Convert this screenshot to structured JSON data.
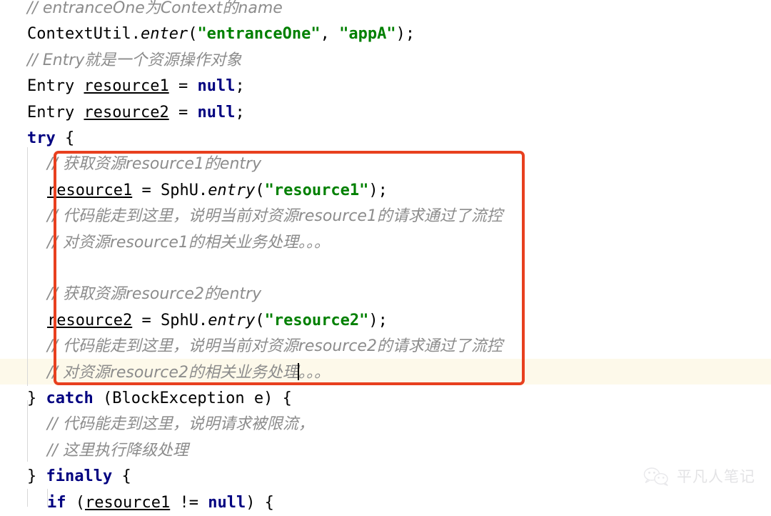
{
  "editor": {
    "language": "Java",
    "theme": "light",
    "caret_line_index": 13,
    "colors": {
      "background": "#ffffff",
      "keyword": "#000080",
      "string": "#008000",
      "comment": "#8c8c8c",
      "plain": "#000000",
      "current_line_highlight": "#fdf9ea",
      "annotation_box": "#e8401f",
      "indent_guide": "#d8d8d8",
      "watermark": "#c9c9cd"
    }
  },
  "annotation": {
    "name": "red-highlight-rectangle",
    "color": "#e8401f",
    "label": "",
    "covers_lines": "5-14"
  },
  "code_lines": [
    {
      "index": 0,
      "indent": 1,
      "tokens": [
        {
          "type": "comment",
          "text": "// entranceOne为Context的name"
        }
      ]
    },
    {
      "index": 1,
      "indent": 1,
      "tokens": [
        {
          "type": "plain",
          "text": "ContextUtil."
        },
        {
          "type": "method",
          "text": "enter"
        },
        {
          "type": "plain",
          "text": "("
        },
        {
          "type": "str",
          "text": "\"entranceOne\""
        },
        {
          "type": "plain",
          "text": ", "
        },
        {
          "type": "str",
          "text": "\"appA\""
        },
        {
          "type": "plain",
          "text": ");"
        }
      ]
    },
    {
      "index": 2,
      "indent": 1,
      "tokens": [
        {
          "type": "comment",
          "text": "// Entry就是一个资源操作对象"
        }
      ]
    },
    {
      "index": 3,
      "indent": 1,
      "tokens": [
        {
          "type": "type",
          "text": "Entry "
        },
        {
          "type": "var",
          "text": "resource1"
        },
        {
          "type": "plain",
          "text": " = "
        },
        {
          "type": "kw",
          "text": "null"
        },
        {
          "type": "plain",
          "text": ";"
        }
      ]
    },
    {
      "index": 4,
      "indent": 1,
      "tokens": [
        {
          "type": "type",
          "text": "Entry "
        },
        {
          "type": "var",
          "text": "resource2"
        },
        {
          "type": "plain",
          "text": " = "
        },
        {
          "type": "kw",
          "text": "null"
        },
        {
          "type": "plain",
          "text": ";"
        }
      ]
    },
    {
      "index": 5,
      "indent": 1,
      "tokens": [
        {
          "type": "kw",
          "text": "try"
        },
        {
          "type": "plain",
          "text": " {"
        }
      ]
    },
    {
      "index": 6,
      "indent": 2,
      "tokens": [
        {
          "type": "comment",
          "text": "// 获取资源resource1的entry"
        }
      ]
    },
    {
      "index": 7,
      "indent": 2,
      "tokens": [
        {
          "type": "var",
          "text": "resource1"
        },
        {
          "type": "plain",
          "text": " = SphU."
        },
        {
          "type": "method",
          "text": "entry"
        },
        {
          "type": "plain",
          "text": "("
        },
        {
          "type": "str",
          "text": "\"resource1\""
        },
        {
          "type": "plain",
          "text": ");"
        }
      ]
    },
    {
      "index": 8,
      "indent": 2,
      "tokens": [
        {
          "type": "comment",
          "text": "// 代码能走到这里，说明当前对资源resource1的请求通过了流控"
        }
      ]
    },
    {
      "index": 9,
      "indent": 2,
      "tokens": [
        {
          "type": "comment",
          "text": "// 对资源resource1的相关业务处理。。。"
        }
      ]
    },
    {
      "index": 10,
      "indent": 2,
      "tokens": []
    },
    {
      "index": 11,
      "indent": 2,
      "tokens": [
        {
          "type": "comment",
          "text": "// 获取资源resource2的entry"
        }
      ]
    },
    {
      "index": 12,
      "indent": 2,
      "tokens": [
        {
          "type": "var",
          "text": "resource2"
        },
        {
          "type": "plain",
          "text": " = SphU."
        },
        {
          "type": "method",
          "text": "entry"
        },
        {
          "type": "plain",
          "text": "("
        },
        {
          "type": "str",
          "text": "\"resource2\""
        },
        {
          "type": "plain",
          "text": ");"
        }
      ]
    },
    {
      "index": 13,
      "indent": 2,
      "tokens": [
        {
          "type": "comment",
          "text": "// 代码能走到这里，说明当前对资源resource2的请求通过了流控"
        }
      ]
    },
    {
      "index": 14,
      "indent": 2,
      "caret_after": "// 对资源resource2的相关业务处理",
      "tokens": [
        {
          "type": "comment",
          "text": "// 对资源resource2的相关业务处理"
        },
        {
          "type": "caret",
          "text": ""
        },
        {
          "type": "comment",
          "text": "。。。"
        }
      ]
    },
    {
      "index": 15,
      "indent": 1,
      "tokens": [
        {
          "type": "plain",
          "text": "} "
        },
        {
          "type": "kw",
          "text": "catch"
        },
        {
          "type": "plain",
          "text": " (BlockException e) {"
        }
      ]
    },
    {
      "index": 16,
      "indent": 2,
      "tokens": [
        {
          "type": "comment",
          "text": "// 代码能走到这里，说明请求被限流，"
        }
      ]
    },
    {
      "index": 17,
      "indent": 2,
      "tokens": [
        {
          "type": "comment",
          "text": "// 这里执行降级处理"
        }
      ]
    },
    {
      "index": 18,
      "indent": 1,
      "tokens": [
        {
          "type": "plain",
          "text": "} "
        },
        {
          "type": "kw",
          "text": "finally"
        },
        {
          "type": "plain",
          "text": " {"
        }
      ]
    },
    {
      "index": 19,
      "indent": 2,
      "tokens": [
        {
          "type": "kw",
          "text": "if"
        },
        {
          "type": "plain",
          "text": " ("
        },
        {
          "type": "var",
          "text": "resource1"
        },
        {
          "type": "plain",
          "text": " != "
        },
        {
          "type": "kw",
          "text": "null"
        },
        {
          "type": "plain",
          "text": ") {"
        }
      ]
    }
  ],
  "watermark": {
    "icon": "wechat-icon",
    "text": "平凡人笔记"
  }
}
